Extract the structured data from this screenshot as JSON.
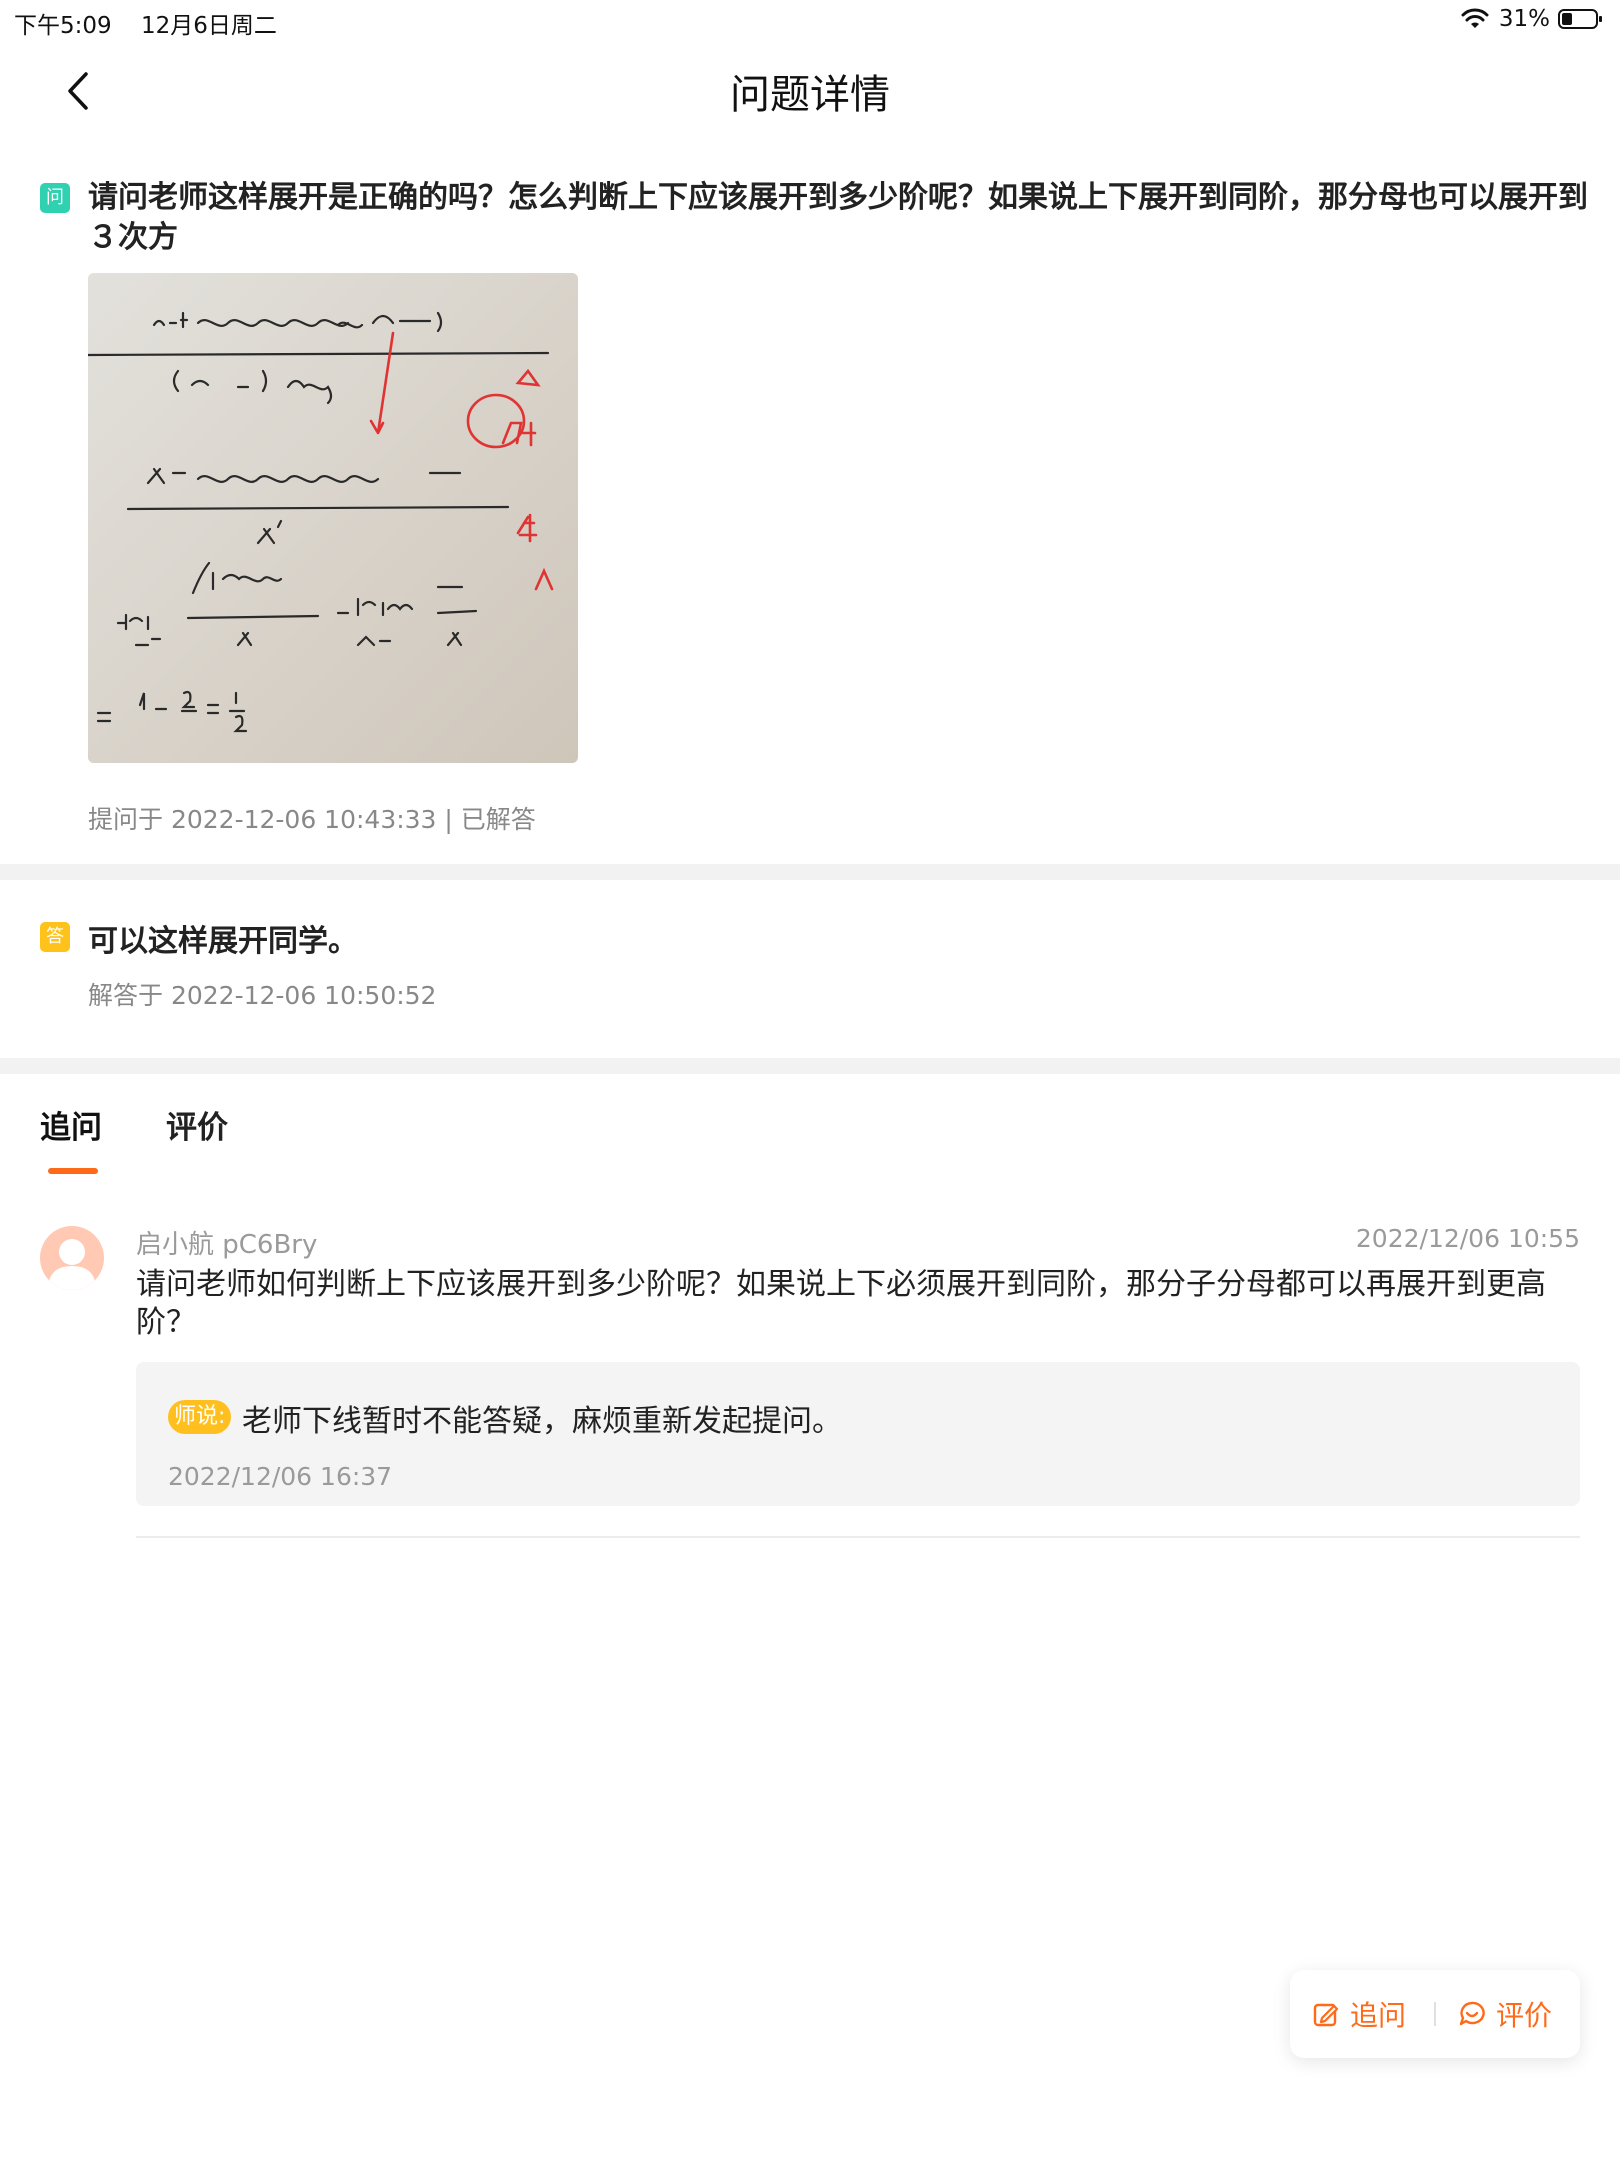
{
  "status_bar": {
    "time": "下午5:09",
    "date": "12月6日周二",
    "battery": "31%"
  },
  "nav": {
    "title": "问题详情"
  },
  "question": {
    "badge": "问",
    "text": "请问老师这样展开是正确的吗？怎么判断上下应该展开到多少阶呢？如果说上下展开到同阶，那分母也可以展开到３次方",
    "meta": "提问于 2022-12-06 10:43:33 | 已解答"
  },
  "answer": {
    "badge": "答",
    "text": "可以这样展开同学。",
    "meta": "解答于 2022-12-06 10:50:52"
  },
  "tabs": [
    {
      "label": "追问",
      "active": true
    },
    {
      "label": "评价",
      "active": false
    }
  ],
  "followup": {
    "user": "启小航 pC6Bry",
    "time": "2022/12/06 10:55",
    "text": "请问老师如何判断上下应该展开到多少阶呢？如果说上下必须展开到同阶，那分子分母都可以再展开到更高阶？",
    "reply": {
      "tag": "师说:",
      "text": "老师下线暂时不能答疑，麻烦重新发起提问。",
      "time": "2022/12/06 16:37"
    }
  },
  "fab": {
    "ask_label": "追问",
    "rate_label": "评价"
  },
  "colors": {
    "accent": "#ff6a1a",
    "question_badge": "#2fd1b0",
    "answer_badge": "#ffc21a",
    "teacher_tag": "#ffbf1f"
  }
}
